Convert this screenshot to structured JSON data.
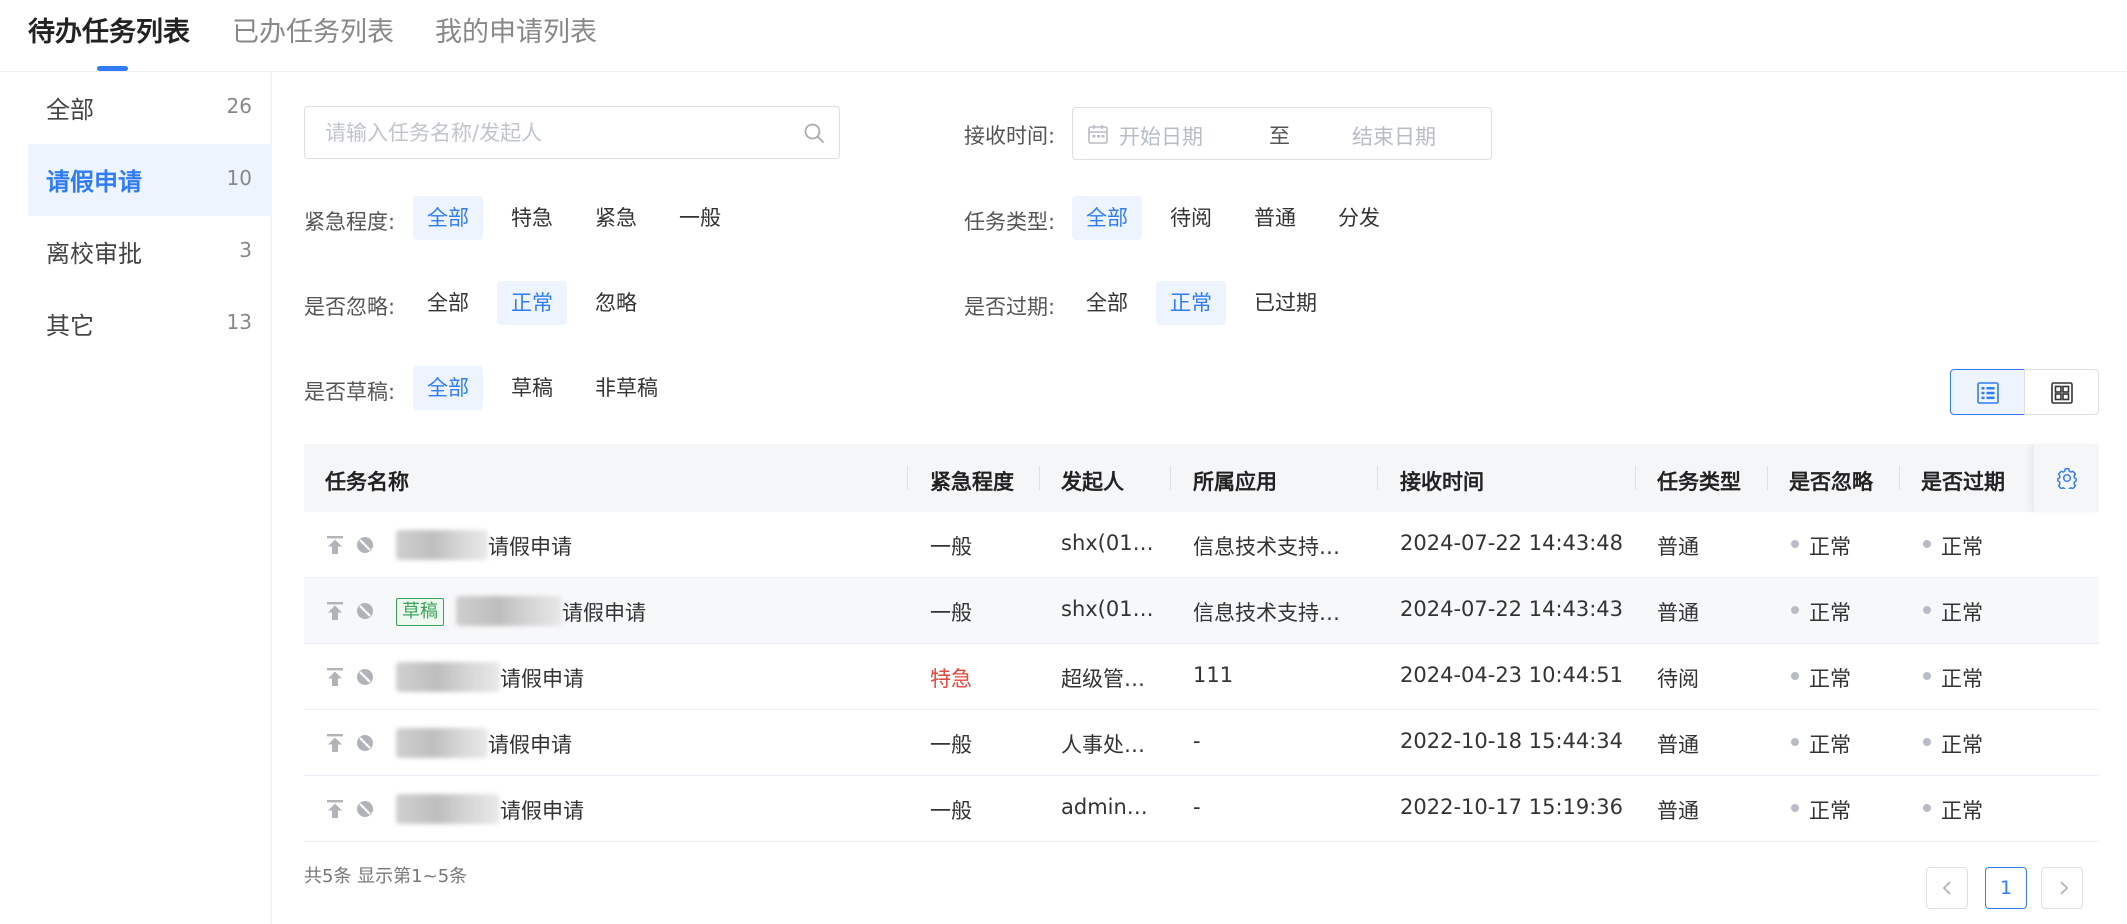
{
  "tabs": [
    "待办任务列表",
    "已办任务列表",
    "我的申请列表"
  ],
  "sidebar": {
    "items": [
      {
        "label": "全部",
        "count": "26"
      },
      {
        "label": "请假申请",
        "count": "10"
      },
      {
        "label": "离校审批",
        "count": "3"
      },
      {
        "label": "其它",
        "count": "13"
      }
    ],
    "active_index": 1
  },
  "search": {
    "placeholder": "请输入任务名称/发起人",
    "icon": "search-icon"
  },
  "filters": {
    "receive_time": {
      "label": "接收时间:",
      "start_placeholder": "开始日期",
      "separator": "至",
      "end_placeholder": "结束日期",
      "icon": "calendar-icon"
    },
    "urgency": {
      "label": "紧急程度:",
      "options": [
        "全部",
        "特急",
        "紧急",
        "一般"
      ],
      "selected": "全部"
    },
    "task_type": {
      "label": "任务类型:",
      "options": [
        "全部",
        "待阅",
        "普通",
        "分发"
      ],
      "selected": "全部"
    },
    "ignored": {
      "label": "是否忽略:",
      "options": [
        "全部",
        "正常",
        "忽略"
      ],
      "selected": "正常"
    },
    "expired": {
      "label": "是否过期:",
      "options": [
        "全部",
        "正常",
        "已过期"
      ],
      "selected": "正常"
    },
    "draft": {
      "label": "是否草稿:",
      "options": [
        "全部",
        "草稿",
        "非草稿"
      ],
      "selected": "全部"
    }
  },
  "view_toggle": {
    "active": "list",
    "icons": [
      "list-view-icon",
      "card-view-icon"
    ]
  },
  "table": {
    "columns": [
      "任务名称",
      "紧急程度",
      "发起人",
      "所属应用",
      "接收时间",
      "任务类型",
      "是否忽略",
      "是否过期"
    ],
    "settings_icon": "gear-icon",
    "rows": [
      {
        "name": "请假申请",
        "urgency": "一般",
        "initiator": "shx(01…",
        "app": "信息技术支持…",
        "received": "2024-07-22 14:43:48",
        "type": "普通",
        "ignored": "正常",
        "expired": "正常",
        "draft": false
      },
      {
        "name": "请假申请",
        "urgency": "一般",
        "initiator": "shx(01…",
        "app": "信息技术支持…",
        "received": "2024-07-22 14:43:43",
        "type": "普通",
        "ignored": "正常",
        "expired": "正常",
        "draft": true,
        "draft_label": "草稿"
      },
      {
        "name": "请假申请",
        "urgency": "特急",
        "initiator": "超级管…",
        "app": "111",
        "received": "2024-04-23 10:44:51",
        "type": "待阅",
        "ignored": "正常",
        "expired": "正常",
        "draft": false
      },
      {
        "name": "请假申请",
        "urgency": "一般",
        "initiator": "人事处…",
        "app": "-",
        "received": "2022-10-18 15:44:34",
        "type": "普通",
        "ignored": "正常",
        "expired": "正常",
        "draft": false
      },
      {
        "name": "请假申请",
        "urgency": "一般",
        "initiator": "admin…",
        "app": "-",
        "received": "2022-10-17 15:19:36",
        "type": "普通",
        "ignored": "正常",
        "expired": "正常",
        "draft": false
      }
    ]
  },
  "pagination": {
    "summary": "共5条 显示第1~5条",
    "current_page": "1"
  },
  "colors": {
    "accent": "#2f7cf6",
    "urgent": "#e8453c",
    "draft": "#3aa35a",
    "selected_bg": "#edf4fe"
  }
}
